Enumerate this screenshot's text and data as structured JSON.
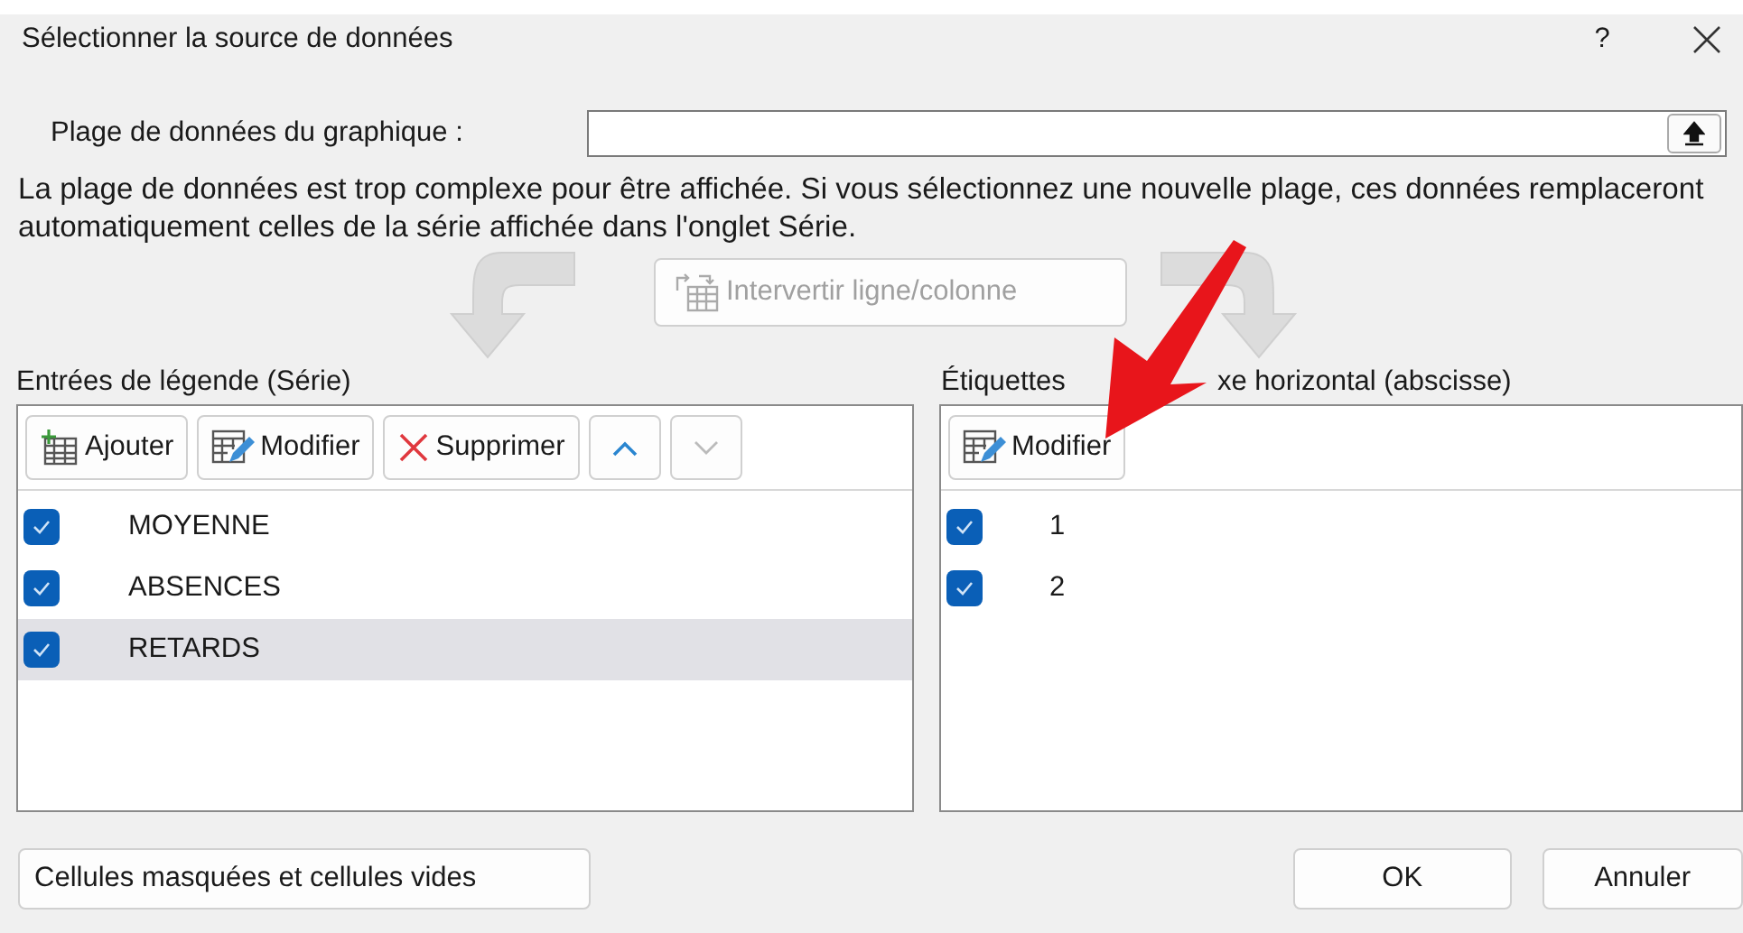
{
  "window": {
    "title": "Sélectionner la source de données",
    "help": "?"
  },
  "range": {
    "label": "Plage de données du graphique :"
  },
  "info": "La plage de données est trop complexe pour être affichée. Si vous sélectionnez une nouvelle plage, ces données remplaceront automatiquement celles de la série affichée dans l'onglet Série.",
  "switch_button": {
    "label": "Intervertir ligne/colonne",
    "disabled": true
  },
  "legend": {
    "title": "Entrées de légende (Série)",
    "toolbar": [
      {
        "kind": "add",
        "label": "Ajouter",
        "disabled": false
      },
      {
        "kind": "edit",
        "label": "Modifier",
        "disabled": false
      },
      {
        "kind": "delete",
        "label": "Supprimer",
        "disabled": false
      },
      {
        "kind": "up",
        "disabled": false
      },
      {
        "kind": "down",
        "disabled": true
      }
    ],
    "series": [
      {
        "name": "MOYENNE",
        "checked": true,
        "selected": false
      },
      {
        "name": "ABSENCES",
        "checked": true,
        "selected": false
      },
      {
        "name": "RETARDS",
        "checked": true,
        "selected": true
      }
    ]
  },
  "axis": {
    "title_parts": [
      "Étiquettes",
      "xe horizontal (abscisse)"
    ],
    "toolbar": [
      {
        "kind": "edit",
        "label": "Modifier",
        "disabled": false
      }
    ],
    "labels": [
      {
        "name": "1",
        "checked": true,
        "selected": false
      },
      {
        "name": "2",
        "checked": true,
        "selected": false
      }
    ]
  },
  "buttons": {
    "hidden_cells": "Cellules masquées et cellules vides",
    "ok": "OK",
    "cancel": "Annuler"
  }
}
